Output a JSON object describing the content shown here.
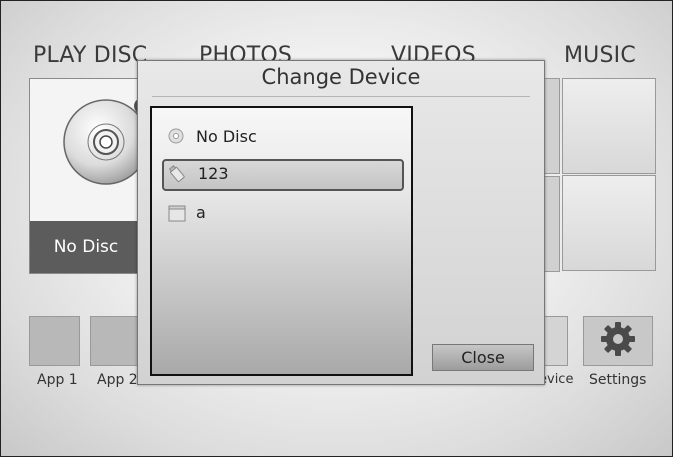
{
  "nav": {
    "play_disc": "PLAY DISC",
    "photos": "PHOTOS",
    "videos": "VIDEOS",
    "music": "MUSIC"
  },
  "disc_panel": {
    "label": "No Disc",
    "icon": "disc-icon"
  },
  "apps": [
    {
      "label": "App 1"
    },
    {
      "label": "App 2"
    }
  ],
  "bottom_right": {
    "device_label": "evice",
    "settings_label": "Settings",
    "settings_icon": "gear-icon"
  },
  "dialog": {
    "title": "Change Device",
    "items": [
      {
        "label": "No Disc",
        "icon": "disc-icon",
        "selected": false
      },
      {
        "label": "123",
        "icon": "usb-drive-icon",
        "selected": true
      },
      {
        "label": "a",
        "icon": "folder-icon",
        "selected": false
      }
    ],
    "close_label": "Close"
  }
}
